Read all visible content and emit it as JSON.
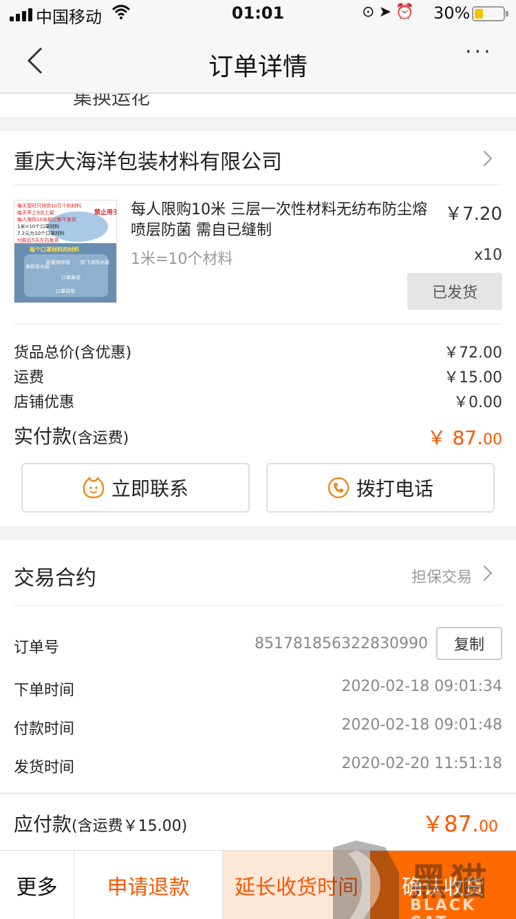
{
  "status_bar": {
    "carrier": "中国移动",
    "time": "01:01",
    "battery_percent": "30%",
    "battery_level": 0.3,
    "icons": [
      "signal-icon",
      "wifi-icon",
      "orientation-lock-icon",
      "location-icon",
      "alarm-icon",
      "battery-icon"
    ]
  },
  "nav": {
    "title": "订单详情",
    "more": "···"
  },
  "peek_text": "集换运花",
  "shop": {
    "name": "重庆大海洋包装材料有限公司"
  },
  "product": {
    "title": "每人限购10米 三层一次性材料无纺布防尘熔喷层防菌 需自已缝制",
    "spec": "1米=10个材料",
    "price": "￥7.20",
    "qty": "x10",
    "status": "已发货",
    "thumb_text": {
      "line1": "每天暂时只排供10万个的材料",
      "line2": "每天早上9点上架",
      "line3": "每人限购10米超过都不发货",
      "line4": "1米=10个口罩材料",
      "line5": "7.2元为10个口罩材料",
      "line6": "付款后5天左右发货",
      "badge": "禁止用于售卖",
      "bottom": "每个口罩材料的材料",
      "label_a": "亲肤吸水层",
      "label_b": "防菌熔喷层",
      "label_c": "防飞沫阻水层",
      "label_d": "口罩鼻梁",
      "label_e": "口罩耳带"
    }
  },
  "summary": {
    "goods_total_label": "货品总价(含优惠)",
    "goods_total_value": "￥72.00",
    "shipping_label": "运费",
    "shipping_value": "￥15.00",
    "shop_discount_label": "店铺优惠",
    "shop_discount_value": "￥0.00",
    "paid_label": "实付款",
    "paid_sub": "(含运费)",
    "paid_main": "￥ 87.",
    "paid_cents": "00"
  },
  "actions": {
    "contact": "立即联系",
    "call": "拨打电话"
  },
  "contract": {
    "title": "交易合约",
    "type": "担保交易",
    "order_no_label": "订单号",
    "order_no": "851781856322830990",
    "copy": "复制",
    "order_time_label": "下单时间",
    "order_time": "2020-02-18 09:01:34",
    "pay_time_label": "付款时间",
    "pay_time": "2020-02-18 09:01:48",
    "ship_time_label": "发货时间",
    "ship_time": "2020-02-20 11:51:18"
  },
  "payable": {
    "label": "应付款",
    "sub": "(含运费￥15.00)",
    "main": "￥87.",
    "cents": "00"
  },
  "bottom_bar": {
    "more": "更多",
    "refund": "申请退款",
    "extend": "延长收货时间",
    "confirm": "确认收货"
  },
  "watermark": {
    "cn": "黑猫",
    "en": "BLACK CAT"
  },
  "colors": {
    "accent": "#ff5500",
    "confirm_bg": "#ff6a00",
    "extend_bg": "#fde7d7"
  }
}
